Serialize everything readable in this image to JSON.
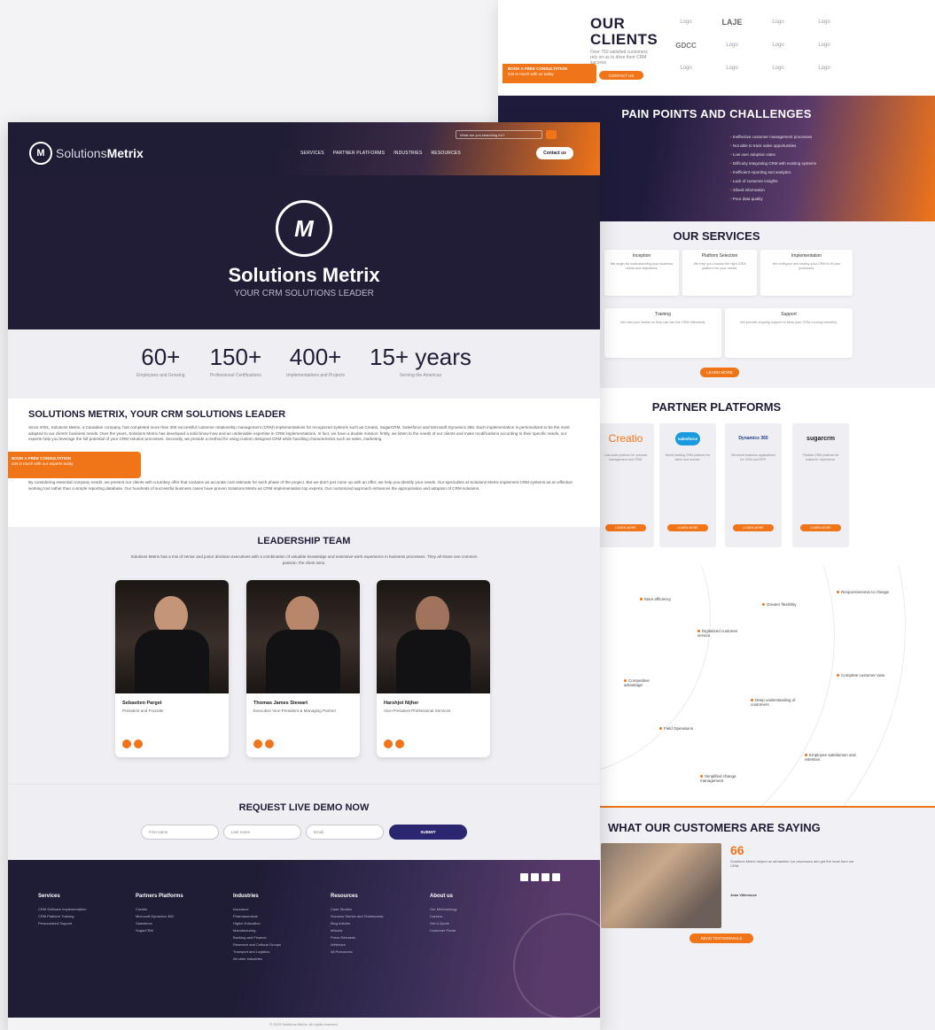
{
  "back": {
    "clients": {
      "title": "OUR CLIENTS",
      "subtitle": "Over 750 satisfied customers rely on us to drive their CRM success"
    },
    "client_logos": [
      "Logo",
      "LAJE",
      "Logo",
      "Logo",
      "GDCC",
      "Logo",
      "Logo",
      "Logo",
      "Logo",
      "Logo",
      "Logo",
      "Logo"
    ],
    "clients_popup": {
      "title": "BOOK A FREE CONSULTATION",
      "line": "Get in touch with us today",
      "button": "CONTACT US"
    },
    "pain": {
      "title": "PAIN POINTS AND CHALLENGES",
      "items": [
        "Ineffective customer management processes",
        "Not able to track sales opportunities",
        "Low user adoption rates",
        "Difficulty integrating CRM with existing systems",
        "Inefficient reporting and analytics",
        "Lack of customer insights",
        "Siloed information",
        "Poor data quality"
      ]
    },
    "services": {
      "title": "OUR SERVICES",
      "cards": [
        {
          "title": "Inception",
          "desc": "We begin by understanding your business needs and objectives."
        },
        {
          "title": "Platform Selection",
          "desc": "We help you choose the right CRM platform for your needs."
        },
        {
          "title": "Implementation",
          "desc": "We configure and deploy your CRM to fit your processes."
        },
        {
          "title": "Training",
          "desc": "We train your teams so they can use the CRM effectively."
        },
        {
          "title": "Support",
          "desc": "We provide ongoing support to keep your CRM running smoothly."
        }
      ],
      "button": "LEARN MORE"
    },
    "partners": {
      "title": "PARTNER PLATFORMS",
      "cards": [
        {
          "name": "Creatio",
          "desc": "Low-code platform for process management and CRM.",
          "color": "#f07418"
        },
        {
          "name": "salesforce",
          "desc": "World leading CRM platform for sales and service.",
          "color": "#1a9be0"
        },
        {
          "name": "Dynamics 365",
          "desc": "Microsoft business applications for CRM and ERP.",
          "color": "#1d3e8a"
        },
        {
          "name": "sugarcrm",
          "desc": "Flexible CRM platform for customer experience.",
          "color": "#222222"
        }
      ],
      "button": "LEARN MORE"
    },
    "benefits": [
      "More efficiency",
      "Greater flexibility",
      "Responsiveness to change",
      "Digitalized customer service",
      "Competitive advantage",
      "Complete customer view",
      "Deep understanding of customers",
      "Field Operations",
      "Employee satisfaction and retention",
      "Simplified change management"
    ],
    "testimonials": {
      "title": "WHAT OUR CUSTOMERS ARE SAYING",
      "quote_mark": "66",
      "text": "Solutions Metrix helped us streamline our processes and get the most from our CRM.",
      "author": "Jean Villeneuve",
      "button": "READ TESTIMONIALS"
    }
  },
  "front": {
    "nav": {
      "brand_light": "Solutions",
      "brand_bold": "Metrix",
      "menu": [
        "SERVICES",
        "PARTNER PLATFORMS",
        "INDUSTRIES",
        "RESOURCES"
      ],
      "search_placeholder": "What are you searching for?",
      "contact": "Contact us"
    },
    "hero": {
      "title": "Solutions Metrix",
      "tagline": "YOUR CRM SOLUTIONS LEADER"
    },
    "stats": [
      {
        "value": "60+",
        "label": "Employees and Growing"
      },
      {
        "value": "150+",
        "label": "Professional Certifications"
      },
      {
        "value": "400+",
        "label": "Implementations and Projects"
      },
      {
        "value": "15+ years",
        "label": "Serving the Americas"
      }
    ],
    "intro": {
      "title": "SOLUTIONS METRIX, YOUR CRM SOLUTIONS LEADER",
      "para1": "Since 2001, Solutions Metrix, a Canadian company, has completed more than 300 successful customer relationship management (CRM) implementations for recognized systems such as Creatio, SugarCRM, Salesforce and Microsoft Dynamics 365. Each implementation is personalized to be the most adapted to our clients' business needs. Over the years, Solutions Metrix has developed a solid know-how and an undeniable expertise in CRM implementations. In fact, we have a double mission: firstly, we listen to the needs of our clients and make modifications according to their specific needs, our experts help you leverage the full potential of your CRM solution processes. Secondly, we provide a method for using custom designed CRM while handling characteristics such as sales, marketing.",
      "para2": "By considering essential company needs, we present our clients with a turnkey offer that contains an accurate cost estimate for each phase of the project. But we don't just come up with an offer; we help you identify your needs. Our specialists at Solutions Metrix implement CRM systems as an effective working tool rather than a simple reporting database. Our hundreds of successful business cases have proven Solutions Metrix as CRM implementation top experts. Our customized approach enhances the appropriation and adoption of CRM solutions.",
      "badge_title": "BOOK A FREE CONSULTATION",
      "badge_line": "Get in touch with our experts today"
    },
    "leadership": {
      "title": "LEADERSHIP TEAM",
      "subtitle": "Solutions Metrix has a mix of senior and junior decision executives with a combination of valuable knowledge and extensive work experience in business processes. They all share one common passion: the client wins.",
      "people": [
        {
          "name": "Sebastien Parget",
          "role": "President and Founder"
        },
        {
          "name": "Thomas James Stewart",
          "role": "Executive Vice-President & Managing Partner"
        },
        {
          "name": "Harshjot Nijher",
          "role": "Vice-President Professional Services"
        }
      ]
    },
    "demo": {
      "title": "REQUEST LIVE DEMO NOW",
      "first_placeholder": "First name",
      "last_placeholder": "Last name",
      "email_placeholder": "Email",
      "submit": "SUBMIT"
    },
    "footer": {
      "columns": [
        {
          "heading": "Services",
          "items": [
            "CRM Software Implementation",
            "CRM Platform Training",
            "Personalized Support"
          ]
        },
        {
          "heading": "Partners Platforms",
          "items": [
            "Creatio",
            "Microsoft Dynamics 365",
            "Salesforce",
            "SugarCRM"
          ]
        },
        {
          "heading": "Industries",
          "items": [
            "Insurance",
            "Pharmaceutical",
            "Higher Education",
            "Manufacturing",
            "Banking and Finance",
            "Research and Cultural Groups",
            "Transport and Logistics",
            "All other industries"
          ]
        },
        {
          "heading": "Resources",
          "items": [
            "Case Studies",
            "Success Stories and Testimonials",
            "Blog Articles",
            "eBooks",
            "Press Releases",
            "Webinars",
            "All Resources"
          ]
        },
        {
          "heading": "About us",
          "items": [
            "Our Methodology",
            "Careers",
            "Get a Quote",
            "Customer Portal"
          ]
        }
      ],
      "copyright": "© 2023 Solutions Metrix. All rights reserved."
    }
  }
}
